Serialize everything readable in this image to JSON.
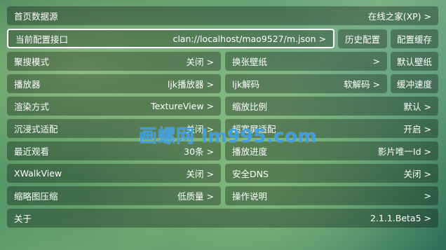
{
  "rows": {
    "home_source": {
      "label": "首页数据源",
      "value": "在线之家(XP) >"
    },
    "config": {
      "label": "当前配置接口",
      "value": "clan://localhost/mao9527/m.json >",
      "history_btn": "历史配置",
      "cache_btn": "配置缓存"
    },
    "search_mode": {
      "label": "聚搜模式",
      "value": "关闭 >"
    },
    "wallpaper": {
      "label": "换张壁纸",
      "value": ">",
      "default_btn": "默认壁纸"
    },
    "player": {
      "label": "播放器",
      "value": "ljk播放器 >"
    },
    "ijk_decode": {
      "label": "ljk解码",
      "value": "软解码 >",
      "buffer_btn": "缓冲速度"
    },
    "render": {
      "label": "渲染方式",
      "value": "TextureView >"
    },
    "scale": {
      "label": "缩放比例",
      "value": "默认 >"
    },
    "immersive": {
      "label": "沉浸式适配",
      "value": "关闭 >"
    },
    "ultrawide": {
      "label": "超宽屏适配",
      "value": "开启 >"
    },
    "recent": {
      "label": "最近观看",
      "value": "30条 >"
    },
    "progress": {
      "label": "播放进度",
      "value": "影片唯一Id >"
    },
    "xwalk": {
      "label": "XWalkView",
      "value": "关闭 >"
    },
    "dns": {
      "label": "安全DNS",
      "value": "关闭 >"
    },
    "thumb": {
      "label": "缩略图压缩",
      "value": "低质量 >"
    },
    "manual": {
      "label": "操作说明",
      "value": ">"
    },
    "about": {
      "label": "关于",
      "value": "2.1.1.Beta5 >"
    }
  },
  "watermark": "画螺网 lm995.com"
}
